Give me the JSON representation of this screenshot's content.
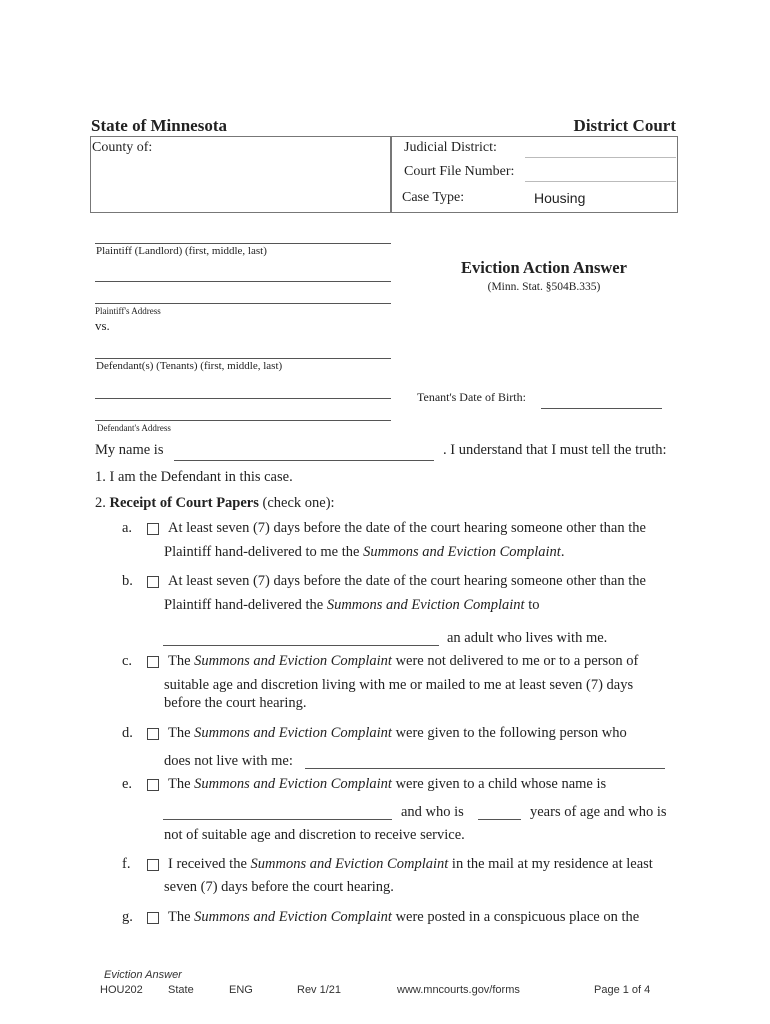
{
  "header": {
    "state": "State of Minnesota",
    "court": "District Court"
  },
  "caption": {
    "county_label": "County of:",
    "judicial_district_label": "Judicial District:",
    "judicial_district_value": "",
    "court_file_number_label": "Court File Number:",
    "court_file_number_value": "",
    "case_type_label": "Case Type:",
    "case_type_value": "Housing"
  },
  "parties": {
    "plaintiff_label": "Plaintiff (Landlord) (first, middle, last)",
    "plaintiff_address_label": "Plaintiff's Address",
    "vs": "vs.",
    "defendant_label": "Defendant(s)  (Tenants) (first, middle, last)",
    "defendant_address_label": "Defendant's Address",
    "tenant_dob_label": "Tenant's Date of Birth:"
  },
  "title": {
    "main": "Eviction Action Answer",
    "statute": "(Minn. Stat.  §504B.335)"
  },
  "intro": {
    "my_name_is": "My name is",
    "truth": ". I understand that I must tell the truth:"
  },
  "item1": "1. I am the Defendant in this case.",
  "item2": {
    "number": "2.",
    "heading": "Receipt of Court Papers",
    "instruction": "(check one):"
  },
  "doc_name": "Summons and Eviction Complaint",
  "options": {
    "a": {
      "letter": "a.",
      "line1": "At least seven (7) days before the date of the court hearing someone other than the",
      "line2_pre": "Plaintiff hand-delivered to me the ",
      "line2_post": ".",
      "checked": false
    },
    "b": {
      "letter": "b.",
      "line1": "At least seven (7) days before the date of the court hearing someone other than the",
      "line2_pre": "Plaintiff hand-delivered the ",
      "line2_post": " to",
      "line3_post": "an adult who lives with me.",
      "checked": false
    },
    "c": {
      "letter": "c.",
      "line1_pre": "The ",
      "line1_post": " were not delivered to me or to a person of",
      "line2": "suitable age and discretion living with me or mailed to me at least seven (7) days",
      "line3": "before the court hearing.",
      "checked": false
    },
    "d": {
      "letter": "d.",
      "line1_pre": "The ",
      "line1_post": " were given to the following person who",
      "line2": "does not live with me:",
      "checked": false
    },
    "e": {
      "letter": "e.",
      "line1_pre": "The ",
      "line1_post": " were given to a child whose name is",
      "line2_mid": "and who is",
      "line2_post": "years of age and who is",
      "line3": "not of suitable age and discretion to receive service.",
      "checked": false
    },
    "f": {
      "letter": "f.",
      "line1_pre": "I received the ",
      "line1_post": " in the mail at my residence at least",
      "line2": "seven (7) days before the court hearing.",
      "checked": false
    },
    "g": {
      "letter": "g.",
      "line1_pre": "The ",
      "line1_post": " were posted in a conspicuous place on the",
      "checked": false
    }
  },
  "footer": {
    "form_title": "Eviction Answer",
    "form_code": "HOU202",
    "jurisdiction": "State",
    "language": "ENG",
    "revision": "Rev 1/21",
    "url": "www.mncourts.gov/forms",
    "page": "Page 1 of 4"
  }
}
